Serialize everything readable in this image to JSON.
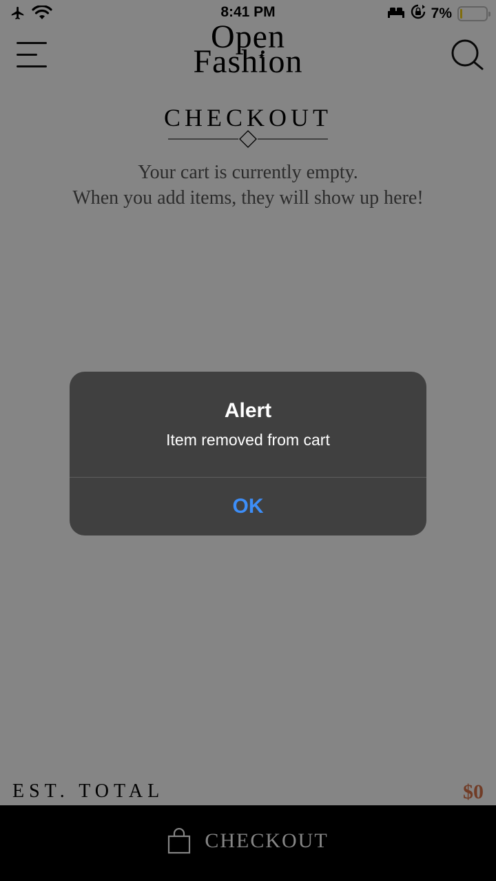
{
  "status_bar": {
    "time": "8:41 PM",
    "battery_percent": "7%",
    "battery_level": 0.07,
    "icons": [
      "airplane-icon",
      "wifi-icon",
      "bed-icon",
      "orientation-lock-icon",
      "battery-icon"
    ]
  },
  "header": {
    "logo_line1": "Open",
    "logo_line2": "Fashion",
    "menu_icon": "hamburger-menu-icon",
    "search_icon": "search-icon"
  },
  "page": {
    "title": "CHECKOUT",
    "empty_line1": "Your cart is currently empty.",
    "empty_line2": "When you add items, they will show up here!"
  },
  "footer": {
    "total_label": "EST. TOTAL",
    "total_value": "$0",
    "checkout_label": "CHECKOUT",
    "checkout_icon": "shopping-bag-icon"
  },
  "alert": {
    "title": "Alert",
    "message": "Item removed from cart",
    "ok_label": "OK"
  },
  "colors": {
    "accent_price": "#d8734a",
    "alert_background": "#404040",
    "alert_button": "#3d8ef8",
    "checkout_bar": "#000000",
    "battery_fill": "#f5d21a"
  }
}
